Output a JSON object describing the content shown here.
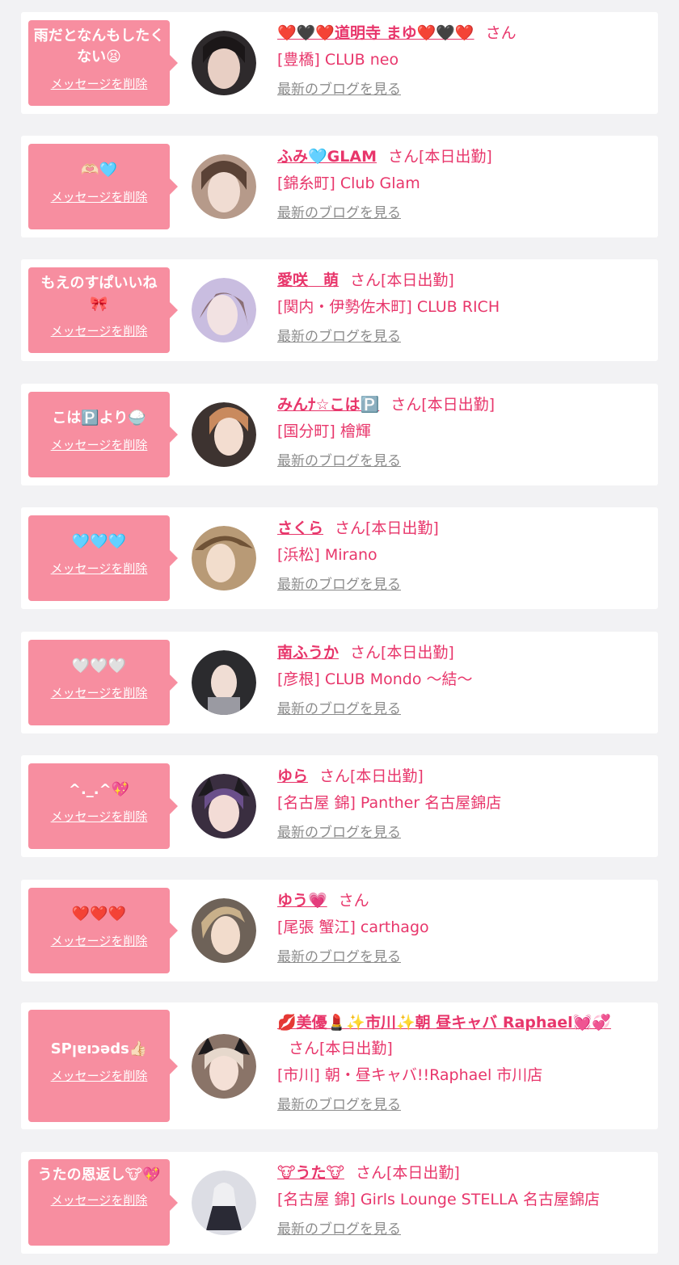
{
  "delete_label": "メッセージを削除",
  "blog_label": "最新のブログを見る",
  "colors": {
    "accent": "#e8366b",
    "bubble": "#f78ea0",
    "background": "#f2f2f4",
    "link_gray": "#8c8c8c"
  },
  "items": [
    {
      "message": "雨だとなんもしたくない😫",
      "name": "❤️🖤❤️道明寺 まゆ❤️🖤❤️",
      "suffix": "さん",
      "shop": "[豊橋] CLUB neo"
    },
    {
      "message": "🫶🏻🩵",
      "name": "ふみ🩵GLAM",
      "suffix": "さん[本日出勤]",
      "shop": "[錦糸町] Club Glam"
    },
    {
      "message": "もえのすぱいいね🎀",
      "name": "愛咲　萌",
      "suffix": "さん[本日出勤]",
      "shop": "[関内・伊勢佐木町] CLUB RICH"
    },
    {
      "message": "こは🅿️より🍚",
      "name": "みんﾅ☆こは🅿️",
      "suffix": "さん[本日出勤]",
      "shop": "[国分町] 檜輝"
    },
    {
      "message": "🩵🩵🩵",
      "name": "さくら",
      "suffix": "さん[本日出勤]",
      "shop": "[浜松] Mirano"
    },
    {
      "message": "🤍🤍🤍",
      "name": "南ふうか",
      "suffix": "さん[本日出勤]",
      "shop": "[彦根] CLUB Mondo 〜結〜"
    },
    {
      "message": "^._.^💖",
      "name": "ゆら",
      "suffix": "さん[本日出勤]",
      "shop": "[名古屋 錦] Panther 名古屋錦店"
    },
    {
      "message": "❤️❤️❤️",
      "name": "ゆう💗",
      "suffix": "さん",
      "shop": "[尾張 蟹江] carthago"
    },
    {
      "message": "SPןɐıɔǝds👍🏻",
      "name": "💋美優💄✨市川✨朝 昼キャバ Raphael💓💞",
      "suffix": "さん[本日出勤]",
      "shop": "[市川] 朝・昼キャバ!!Raphael 市川店"
    },
    {
      "message": "うたの恩返し🐮💖",
      "name": "🐮うた🐮",
      "suffix": "さん[本日出勤]",
      "shop": "[名古屋 錦] Girls Lounge STELLA 名古屋錦店"
    }
  ]
}
